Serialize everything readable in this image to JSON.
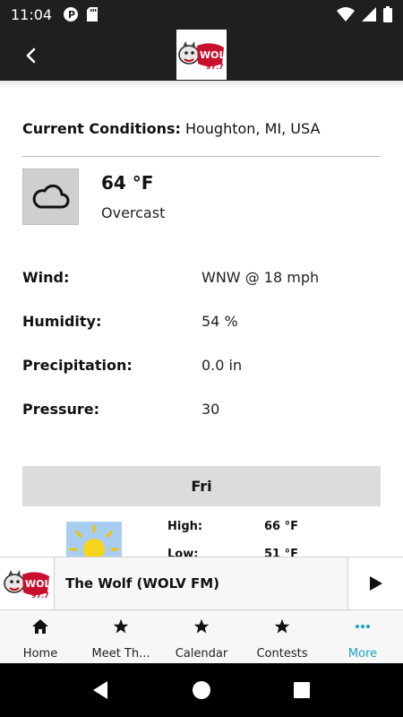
{
  "status_bar": {
    "time": "11:04"
  },
  "app_bar": {
    "logo_alt": "The Wolf 97.7"
  },
  "current": {
    "label": "Current Conditions:",
    "location": "Houghton, MI, USA",
    "temperature": "64 °F",
    "condition": "Overcast",
    "icon": "cloud-icon"
  },
  "details": [
    {
      "label": "Wind:",
      "value": "WNW @ 18 mph"
    },
    {
      "label": "Humidity:",
      "value": "54 %"
    },
    {
      "label": "Precipitation:",
      "value": "0.0 in"
    },
    {
      "label": "Pressure:",
      "value": "30"
    }
  ],
  "forecast": {
    "day": "Fri",
    "icon": "sun-icon",
    "high_label": "High:",
    "high_value": "66 °F",
    "low_label": "Low:",
    "low_value": "51 °F"
  },
  "player": {
    "station": "The Wolf (WOLV FM)"
  },
  "nav": [
    {
      "label": "Home",
      "icon": "home-icon"
    },
    {
      "label": "Meet Th...",
      "icon": "star-icon"
    },
    {
      "label": "Calendar",
      "icon": "star-icon"
    },
    {
      "label": "Contests",
      "icon": "star-icon"
    },
    {
      "label": "More",
      "icon": "more-icon"
    }
  ],
  "colors": {
    "accent": "#1da1c9",
    "bar": "#1f1f1f",
    "day_bar": "#dcdcdc",
    "sky": "#a9cdf0"
  }
}
